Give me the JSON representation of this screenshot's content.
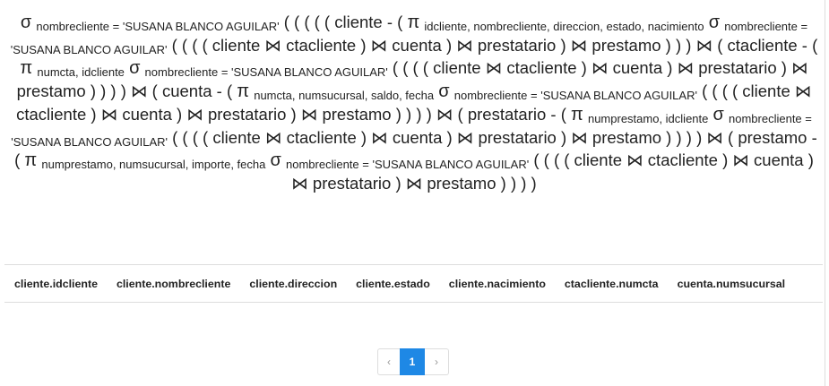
{
  "expression": {
    "parts": [
      {
        "t": "op",
        "v": "σ"
      },
      {
        "t": "sub",
        "v": "nombrecliente = 'SUSANA BLANCO AGUILAR'"
      },
      {
        "t": "txt",
        "v": "( ( ( ( ( cliente - ( "
      },
      {
        "t": "op",
        "v": "π"
      },
      {
        "t": "sub",
        "v": "idcliente, nombrecliente, direccion, estado, nacimiento"
      },
      {
        "t": "op",
        "v": "σ"
      },
      {
        "t": "sub",
        "v": "nombrecliente = 'SUSANA BLANCO AGUILAR'"
      },
      {
        "t": "txt",
        "v": "( ( ( ( cliente ⋈ ctacliente ) ⋈ cuenta ) ⋈ prestatario ) ⋈ prestamo ) ) ) ⋈ ( ctacliente - ( "
      },
      {
        "t": "op",
        "v": "π"
      },
      {
        "t": "sub",
        "v": "numcta, idcliente"
      },
      {
        "t": "op",
        "v": "σ"
      },
      {
        "t": "sub",
        "v": "nombrecliente = 'SUSANA BLANCO AGUILAR'"
      },
      {
        "t": "txt",
        "v": "( ( ( ( cliente ⋈ ctacliente ) ⋈ cuenta ) ⋈ prestatario ) ⋈ prestamo ) ) ) ) ⋈ ( cuenta - ( "
      },
      {
        "t": "op",
        "v": "π"
      },
      {
        "t": "sub",
        "v": "numcta, numsucursal, saldo, fecha"
      },
      {
        "t": "op",
        "v": "σ"
      },
      {
        "t": "sub",
        "v": "nombrecliente = 'SUSANA BLANCO AGUILAR'"
      },
      {
        "t": "txt",
        "v": "( ( ( ( cliente ⋈ ctacliente ) ⋈ cuenta ) ⋈ prestatario ) ⋈ prestamo ) ) ) ) ⋈ ( prestatario - ( "
      },
      {
        "t": "op",
        "v": "π"
      },
      {
        "t": "sub",
        "v": "numprestamo, idcliente"
      },
      {
        "t": "op",
        "v": "σ"
      },
      {
        "t": "sub",
        "v": "nombrecliente = 'SUSANA BLANCO AGUILAR'"
      },
      {
        "t": "txt",
        "v": "( ( ( ( cliente ⋈ ctacliente ) ⋈ cuenta ) ⋈ prestatario ) ⋈ prestamo ) ) ) ) ⋈ ( prestamo - ( "
      },
      {
        "t": "op",
        "v": "π"
      },
      {
        "t": "sub",
        "v": "numprestamo, numsucursal, importe, fecha"
      },
      {
        "t": "op",
        "v": "σ"
      },
      {
        "t": "sub",
        "v": "nombrecliente = 'SUSANA BLANCO AGUILAR'"
      },
      {
        "t": "txt",
        "v": "( ( ( ( cliente ⋈ ctacliente ) ⋈ cuenta ) ⋈ prestatario ) ⋈ prestamo ) ) ) )"
      }
    ]
  },
  "table": {
    "headers": [
      "cliente.idcliente",
      "cliente.nombrecliente",
      "cliente.direccion",
      "cliente.estado",
      "cliente.nacimiento",
      "ctacliente.numcta",
      "cuenta.numsucursal"
    ]
  },
  "pagination": {
    "prev_label": "‹",
    "current_page": "1",
    "next_label": "›"
  },
  "colors": {
    "text": "#222222",
    "accent": "#1e88e5",
    "border": "#dddddd"
  }
}
